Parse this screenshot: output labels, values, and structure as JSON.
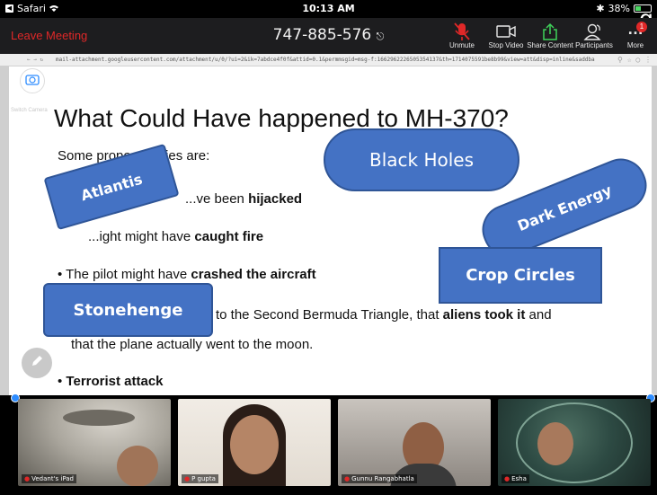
{
  "status_bar": {
    "app": "Safari",
    "time": "10:13 AM",
    "battery": "38%",
    "battery_level": 0.38,
    "right_edge_glyph": "g"
  },
  "meeting": {
    "leave_label": "Leave Meeting",
    "id": "747-885-576"
  },
  "controls": [
    {
      "label": "Unmute",
      "icon": "mic-muted-icon"
    },
    {
      "label": "Stop Video",
      "icon": "video-icon"
    },
    {
      "label": "Share Content",
      "icon": "share-icon"
    },
    {
      "label": "Participants",
      "icon": "participants-icon"
    },
    {
      "label": "More",
      "icon": "more-icon",
      "badge": "1"
    }
  ],
  "browser": {
    "url": "mail-attachment.googleusercontent.com/attachment/u/0/?ui=2&ik=7abdce4f0f&attid=0.1&permmsgid=msg-f:1662962226505354137&th=1714075591be8b99&view=att&disp=inline&saddbat..."
  },
  "switch_camera_label": "Switch Camera",
  "slide": {
    "title": "What Could Have happened to MH-370?",
    "intro": "Some propo... eories are:",
    "lines": [
      {
        "pre": "...ve been ",
        "bold": "hijacked",
        "post": ""
      },
      {
        "pre": "...ight might have ",
        "bold": "caught fire",
        "post": ""
      },
      {
        "pre": "• The pilot might have ",
        "bold": "crashed the aircraft",
        "post": ""
      },
      {
        "pre": "to the Second Bermuda Triangle, that ",
        "bold": "aliens took it",
        "post": " and"
      },
      {
        "pre": "that the plane actually went to the moon.",
        "bold": "",
        "post": ""
      },
      {
        "pre": "• ",
        "bold": "Terrorist attack",
        "post": ""
      }
    ]
  },
  "annotations": [
    "Atlantis",
    "Black Holes",
    "Dark Energy",
    "Crop Circles",
    "Stonehenge"
  ],
  "colors": {
    "sticker": "#4472c4",
    "sticker_border": "#2f5597",
    "leave": "#e02828",
    "zoom_bar": "#1d1d1f"
  },
  "participants": [
    {
      "name": "Vedant's iPad"
    },
    {
      "name": "P gupta"
    },
    {
      "name": "Gunnu Rangabhatla"
    },
    {
      "name": "Esha"
    }
  ]
}
